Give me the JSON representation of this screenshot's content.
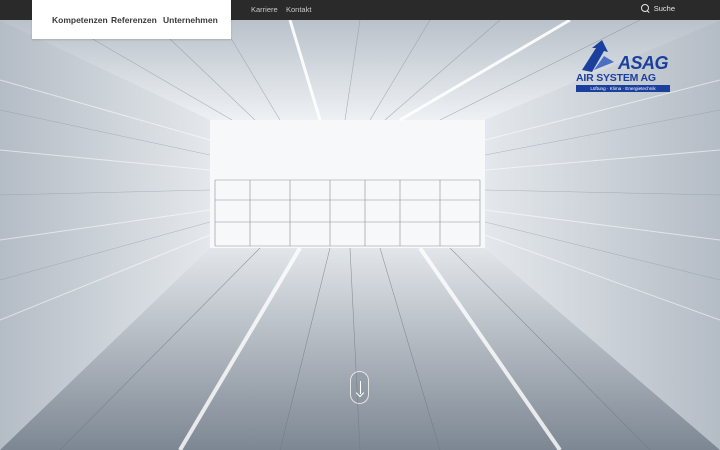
{
  "topbar": {
    "secondary_nav": [
      {
        "label": "Karriere"
      },
      {
        "label": "Kontakt"
      }
    ],
    "search_label": "Suche"
  },
  "primary_nav": [
    {
      "label": "Kompetenzen"
    },
    {
      "label": "Referenzen"
    },
    {
      "label": "Unternehmen"
    }
  ],
  "logo": {
    "brand": "ASAG",
    "company": "AIR SYSTEM AG",
    "tagline": "Lüftung · Klima · Energietechnik",
    "color": "#1b3f9c"
  },
  "hero": {
    "scroll_indicator_icon": "arrow-down-icon"
  }
}
